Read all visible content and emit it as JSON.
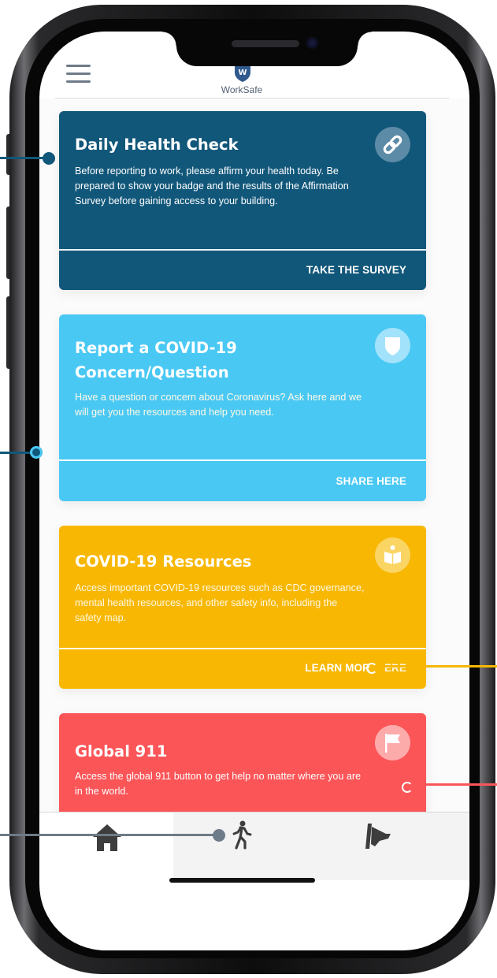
{
  "app": {
    "brand": "WorkSafe",
    "logo_letter": "W"
  },
  "cards": [
    {
      "title": "Daily Health Check",
      "description": "Before reporting to work, please affirm your health today.  Be prepared to show your badge and the results of the Affirmation Survey before gaining access to your building.",
      "action": "TAKE THE SURVEY",
      "icon": "link-icon",
      "color": "#11577a"
    },
    {
      "title": "Report a COVID-19 Concern/Question",
      "title_lines": [
        "Report a COVID-19",
        "Concern/Question"
      ],
      "description": "Have a question or concern about Coronavirus? Ask here and we will get you the resources and help you need.",
      "action": "SHARE HERE",
      "icon": "shield-icon",
      "color": "#4ac8f4"
    },
    {
      "title": "COVID-19 Resources",
      "description": "Access important COVID-19 resources such as CDC governance, mental health resources, and other safety info, including the safety map.",
      "action": "LEARN MORE HERE",
      "action_visible": "LEARN MOR",
      "action_tail": "ERE",
      "icon": "book-icon",
      "color": "#f7b702"
    },
    {
      "title": "Global 911",
      "description": "Access the global 911 button to get help no matter where you are in the world.",
      "icon": "flag-icon",
      "color": "#fb5558"
    }
  ],
  "tabbar": {
    "items": [
      {
        "name": "home",
        "icon": "home-icon",
        "selected": true
      },
      {
        "name": "walk",
        "icon": "walking-person-icon",
        "selected": false
      },
      {
        "name": "safety",
        "icon": "flag-hand-icon",
        "selected": false
      }
    ]
  },
  "callouts": {
    "colors": [
      "#11577a",
      "#4ac8f4",
      "#f7b702",
      "#fb5558",
      "#6e7b88"
    ]
  }
}
